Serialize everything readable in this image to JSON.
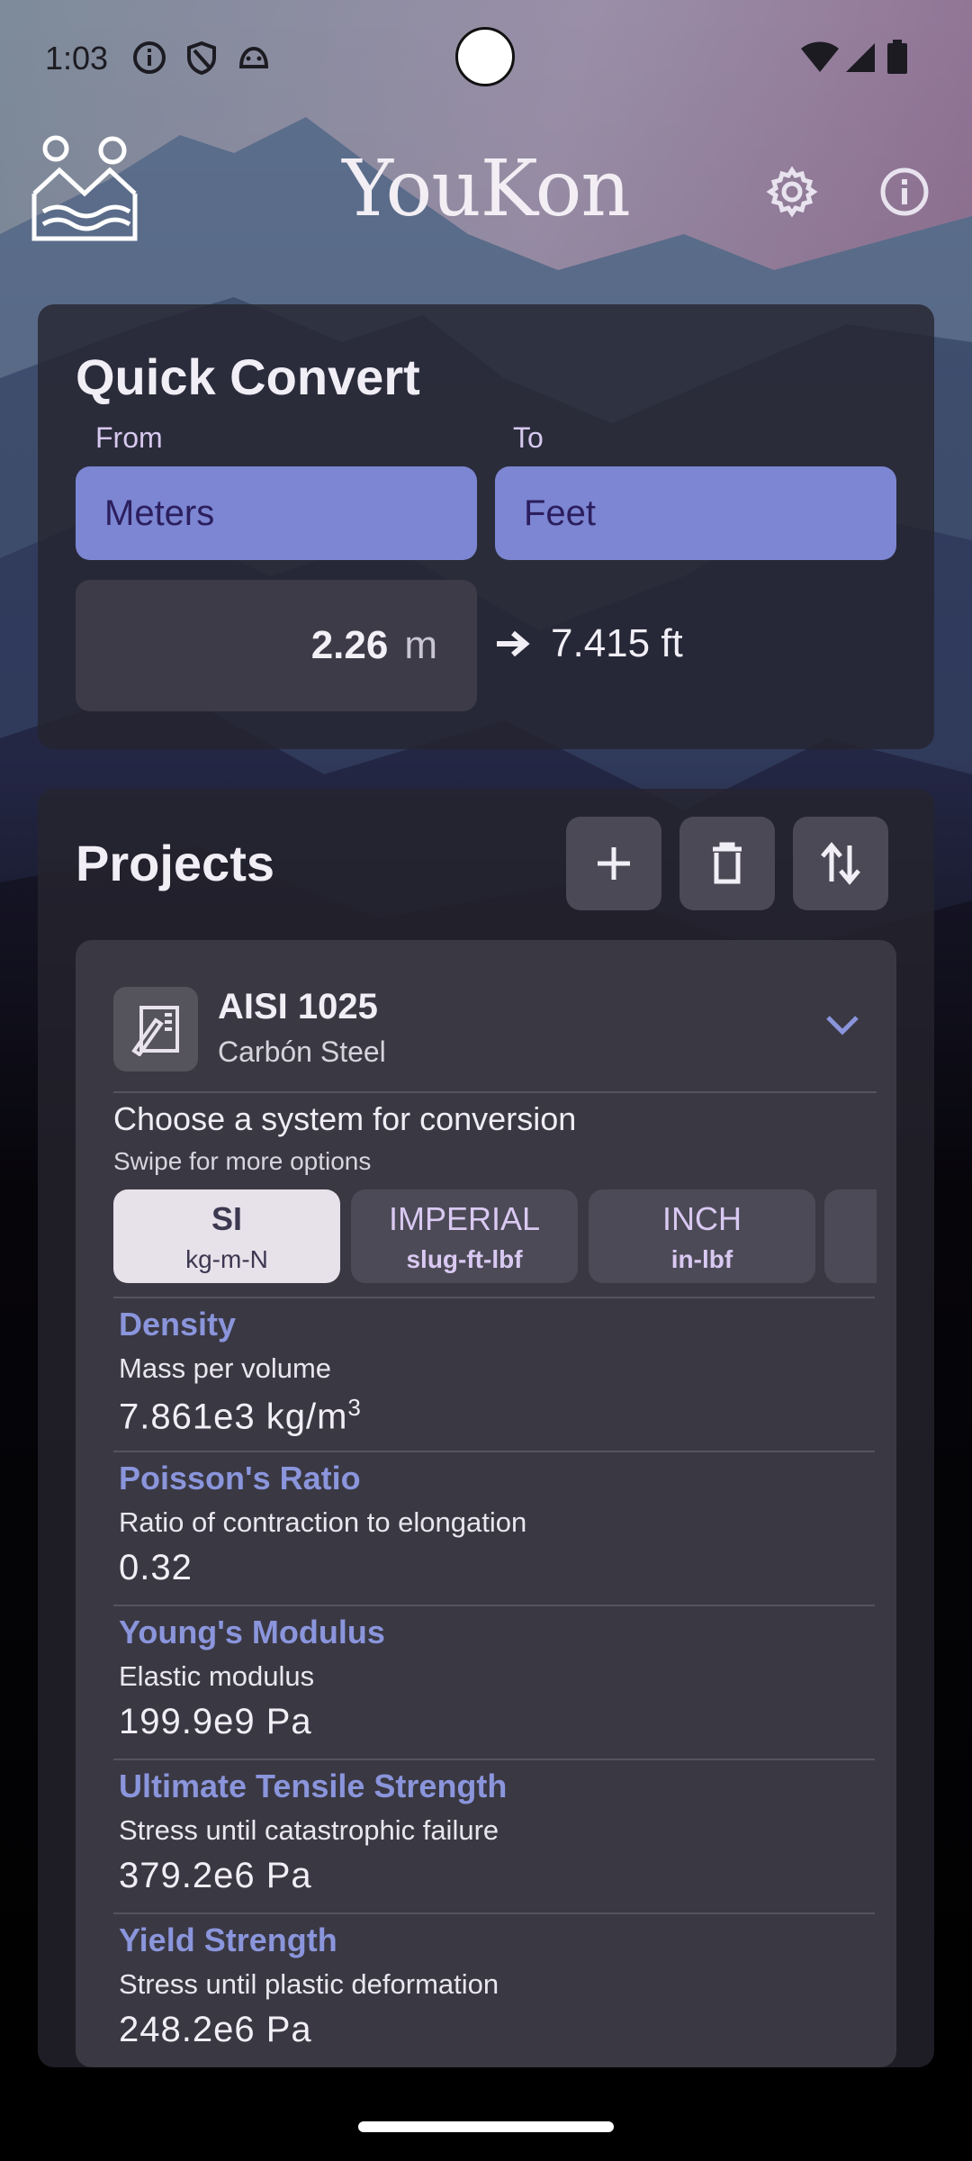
{
  "status_bar": {
    "time": "1:03",
    "icons": [
      "info-icon",
      "shield-icon",
      "android-icon"
    ],
    "right_icons": [
      "wifi-icon",
      "signal-icon",
      "battery-icon"
    ]
  },
  "header": {
    "title": "YouKon",
    "logo_icon": "youkon-logo",
    "settings_icon": "gear-icon",
    "info_icon": "info-icon"
  },
  "quick_convert": {
    "title": "Quick Convert",
    "from_label": "From",
    "to_label": "To",
    "from_unit": "Meters",
    "to_unit": "Feet",
    "input_value": "2.26",
    "input_unit": "m",
    "result": "7.415 ft"
  },
  "projects": {
    "title": "Projects",
    "actions": [
      "add-icon",
      "trash-icon",
      "swap-vertical-icon"
    ],
    "item": {
      "name": "AISI 1025",
      "subtitle": "Carbón Steel",
      "choose_text": "Choose a system for conversion",
      "swipe_text": "Swipe for more options",
      "systems": [
        {
          "name": "SI",
          "sub": "kg-m-N",
          "active": true
        },
        {
          "name": "IMPERIAL",
          "sub": "slug-ft-lbf",
          "active": false
        },
        {
          "name": "INCH",
          "sub": "in-lbf",
          "active": false
        }
      ],
      "properties": [
        {
          "name": "Density",
          "desc": "Mass per volume",
          "value": "7.861e3 kg/m",
          "sup": "3"
        },
        {
          "name": "Poisson's Ratio",
          "desc": "Ratio of contraction to elongation",
          "value": "0.32"
        },
        {
          "name": "Young's Modulus",
          "desc": "Elastic modulus",
          "value": "199.9e9 Pa"
        },
        {
          "name": "Ultimate Tensile Strength",
          "desc": "Stress until catastrophic failure",
          "value": "379.2e6 Pa"
        },
        {
          "name": "Yield Strength",
          "desc": "Stress until plastic deformation",
          "value": "248.2e6 Pa"
        }
      ]
    }
  },
  "colors": {
    "accent": "#7c86d2",
    "property_name": "#8a95dc",
    "card": "#26242e",
    "item": "#3a3843"
  }
}
